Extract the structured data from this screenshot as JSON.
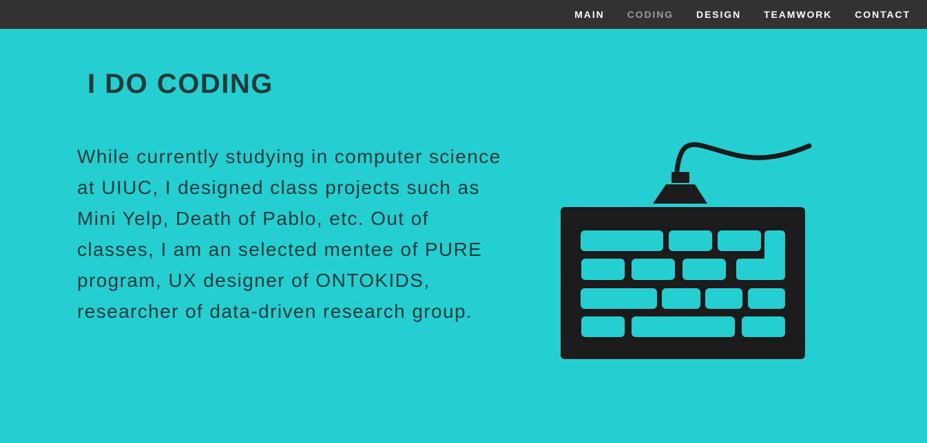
{
  "nav": {
    "items": [
      {
        "label": "MAIN",
        "active": false
      },
      {
        "label": "CODING",
        "active": true
      },
      {
        "label": "DESIGN",
        "active": false
      },
      {
        "label": "TEAMWORK",
        "active": false
      },
      {
        "label": "CONTACT",
        "active": false
      }
    ]
  },
  "section": {
    "title": "I DO CODING",
    "body": "While currently studying in computer science at UIUC, I designed class projects such as Mini Yelp, Death of Pablo, etc. Out of classes, I am an selected mentee of PURE program, UX designer of ONTOKIDS, researcher of data-driven research group.",
    "illustration_icon": "keyboard-icon"
  },
  "colors": {
    "background": "#24CFD2",
    "navbar": "#333132",
    "nav_text": "#FFFFFF",
    "nav_active": "#9A9A9A",
    "heading": "#24393A",
    "body_text": "#1E3A3B",
    "icon": "#1B1B1B"
  }
}
